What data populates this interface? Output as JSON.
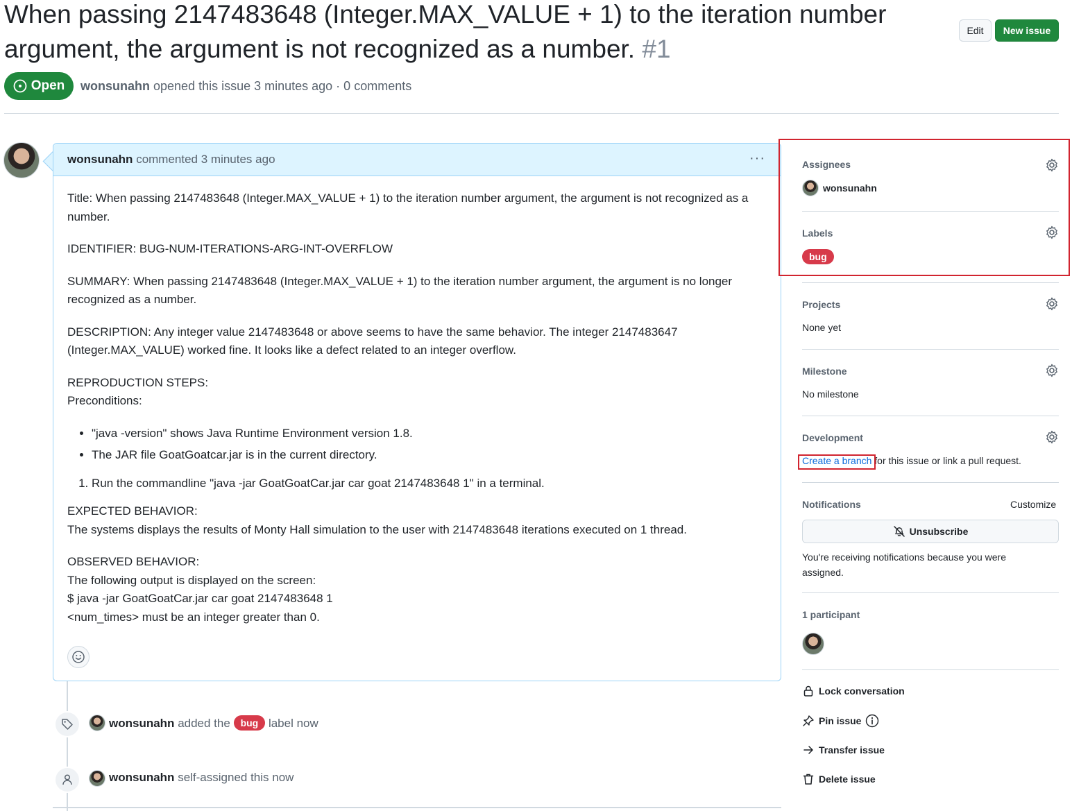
{
  "issue": {
    "title": "When passing 2147483648 (Integer.MAX_VALUE + 1) to the iteration number argument, the argument is not recognized as a number.",
    "number": "#1",
    "state": "Open",
    "author": "wonsunahn",
    "opened_text": "opened this issue 3 minutes ago · 0 comments"
  },
  "header": {
    "edit_label": "Edit",
    "new_issue_label": "New issue"
  },
  "comment": {
    "author": "wonsunahn",
    "meta": "commented 3 minutes ago",
    "menu_label": "···",
    "body": {
      "title_line": "Title: When passing 2147483648 (Integer.MAX_VALUE + 1) to the iteration number argument, the argument is not recognized as a number.",
      "identifier": "IDENTIFIER: BUG-NUM-ITERATIONS-ARG-INT-OVERFLOW",
      "summary": "SUMMARY: When passing 2147483648 (Integer.MAX_VALUE + 1) to the iteration number argument, the argument is no longer recognized as a number.",
      "description": "DESCRIPTION: Any integer value 2147483648 or above seems to have the same behavior. The integer 2147483647 (Integer.MAX_VALUE) worked fine. It looks like a defect related to an integer overflow.",
      "repro_heading": "REPRODUCTION STEPS:",
      "preconditions": "Preconditions:",
      "precondition_items": [
        "\"java -version\" shows Java Runtime Environment version 1.8.",
        "The JAR file GoatGoatcar.jar is in the current directory."
      ],
      "steps": [
        "Run the commandline \"java -jar GoatGoatCar.jar car goat 2147483648 1\" in a terminal."
      ],
      "expected_heading": "EXPECTED BEHAVIOR:",
      "expected_text": "The systems displays the results of Monty Hall simulation to the user with 2147483648 iterations executed on 1 thread.",
      "observed_heading": "OBSERVED BEHAVIOR:",
      "observed_lines": [
        "The following output is displayed on the screen:",
        "$ java -jar GoatGoatCar.jar car goat 2147483648 1",
        "<num_times> must be an integer greater than 0."
      ]
    }
  },
  "events": [
    {
      "icon": "tag-icon",
      "author": "wonsunahn",
      "before": "added the",
      "label": "bug",
      "after": "label now"
    },
    {
      "icon": "person-icon",
      "author": "wonsunahn",
      "text": "self-assigned this now"
    }
  ],
  "sidebar": {
    "assignees": {
      "heading": "Assignees",
      "name": "wonsunahn"
    },
    "labels": {
      "heading": "Labels",
      "label": "bug",
      "label_color": "#d73a4a"
    },
    "projects": {
      "heading": "Projects",
      "value": "None yet"
    },
    "milestone": {
      "heading": "Milestone",
      "value": "No milestone"
    },
    "development": {
      "heading": "Development",
      "link": "Create a branch",
      "rest": "for this issue or link a pull request."
    },
    "notifications": {
      "heading": "Notifications",
      "customize": "Customize",
      "unsubscribe": "Unsubscribe",
      "reason": "You're receiving notifications because you were assigned."
    },
    "participants": {
      "heading": "1 participant"
    },
    "actions": {
      "lock": "Lock conversation",
      "pin": "Pin issue",
      "transfer": "Transfer issue",
      "delete": "Delete issue"
    }
  },
  "colors": {
    "open_green": "#1f883d",
    "bug_red": "#d73a4a",
    "link_blue": "#0969da",
    "highlight_red": "#d1242f",
    "comment_header_blue": "#ddf4ff"
  }
}
